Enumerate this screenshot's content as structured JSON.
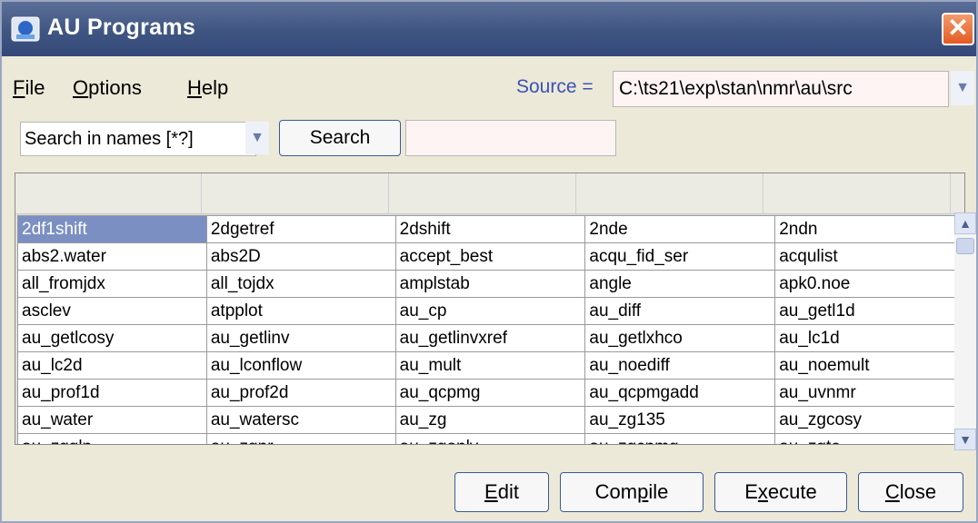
{
  "window": {
    "title": "AU Programs"
  },
  "menu": [
    {
      "mnemonic": "F",
      "rest": "ile"
    },
    {
      "mnemonic": "O",
      "rest": "ptions"
    },
    {
      "mnemonic": "H",
      "rest": "elp"
    }
  ],
  "source": {
    "label": "Source =",
    "value": "C:\\ts21\\exp\\stan\\nmr\\au\\src"
  },
  "search": {
    "mode": "Search in names [*?]",
    "button": "Search",
    "query": ""
  },
  "grid": {
    "rows": [
      [
        "2df1shift",
        "2dgetref",
        "2dshift",
        "2nde",
        "2ndn"
      ],
      [
        "abs2.water",
        "abs2D",
        "accept_best",
        "acqu_fid_ser",
        "acqulist"
      ],
      [
        "all_fromjdx",
        "all_tojdx",
        "amplstab",
        "angle",
        "apk0.noe"
      ],
      [
        "asclev",
        "atpplot",
        "au_cp",
        "au_diff",
        "au_getl1d"
      ],
      [
        "au_getlcosy",
        "au_getlinv",
        "au_getlinvxref",
        "au_getlxhco",
        "au_lc1d"
      ],
      [
        "au_lc2d",
        "au_lconflow",
        "au_mult",
        "au_noediff",
        "au_noemult"
      ],
      [
        "au_prof1d",
        "au_prof2d",
        "au_qcpmg",
        "au_qcpmgadd",
        "au_uvnmr"
      ],
      [
        "au_water",
        "au_watersc",
        "au_zg",
        "au_zg135",
        "au_zgcosy"
      ],
      [
        "au_zgglp",
        "au_zgpr",
        "au_zgonly",
        "au_zgcpmg",
        "au_zgte"
      ]
    ],
    "selected": "2df1shift"
  },
  "buttons": {
    "edit": {
      "mnemonic": "E",
      "rest": "dit"
    },
    "compile": {
      "before": "Com",
      "mnemonic": "p",
      "after": "ile"
    },
    "execute": {
      "before": "E",
      "mnemonic": "x",
      "after": "ecute"
    },
    "close": {
      "mnemonic": "C",
      "rest": "lose"
    }
  },
  "colors": {
    "titlebar": "#3f5581",
    "selection": "#7b8fc2",
    "source_label": "#3a52b6"
  },
  "icons": [
    "app-icon",
    "close-icon",
    "dropdown-arrow-icon",
    "scroll-up-icon",
    "scroll-down-icon"
  ]
}
